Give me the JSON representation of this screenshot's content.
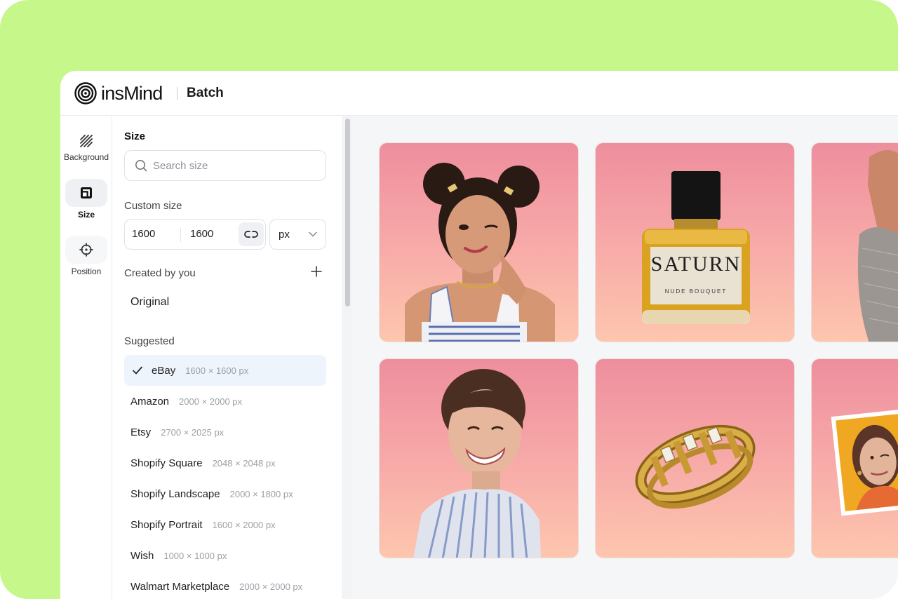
{
  "app": {
    "brand": "insMind",
    "section": "Batch"
  },
  "rail": {
    "items": [
      {
        "label": "Background",
        "icon": "background-hatch-icon",
        "active": false
      },
      {
        "label": "Size",
        "icon": "size-crop-icon",
        "active": true
      },
      {
        "label": "Position",
        "icon": "crosshair-icon",
        "active": false
      }
    ]
  },
  "panel": {
    "title": "Size",
    "search_placeholder": "Search size",
    "custom_size_label": "Custom size",
    "width": "1600",
    "height": "1600",
    "unit": "px",
    "created_label": "Created by you",
    "original_label": "Original",
    "suggested_label": "Suggested",
    "suggested": [
      {
        "name": "eBay",
        "dims": "1600 × 1600 px",
        "selected": true
      },
      {
        "name": "Amazon",
        "dims": "2000 × 2000 px",
        "selected": false
      },
      {
        "name": "Etsy",
        "dims": "2700 × 2025 px",
        "selected": false
      },
      {
        "name": "Shopify Square",
        "dims": "2048 × 2048 px",
        "selected": false
      },
      {
        "name": "Shopify Landscape",
        "dims": "2000 × 1800 px",
        "selected": false
      },
      {
        "name": "Shopify Portrait",
        "dims": "1600 × 2000 px",
        "selected": false
      },
      {
        "name": "Wish",
        "dims": "1000 × 1000 px",
        "selected": false
      },
      {
        "name": "Walmart Marketplace",
        "dims": "2000 × 2000 px",
        "selected": false
      }
    ]
  },
  "canvas": {
    "perfume_label": "SATURN",
    "perfume_sub": "NUDE BOUQUET",
    "cards": [
      {
        "subject": "woman-with-space-buns"
      },
      {
        "subject": "perfume-bottle"
      },
      {
        "subject": "mule-shoe"
      },
      {
        "subject": "smiling-woman-striped-shirt"
      },
      {
        "subject": "gold-ring"
      },
      {
        "subject": "woman-photo-print"
      }
    ]
  },
  "colors": {
    "frame_green": "#c6f78a",
    "card_gradient_top": "#ee8e9e",
    "card_gradient_bottom": "#fdc6ae",
    "selected_bg": "#eef4fc"
  }
}
